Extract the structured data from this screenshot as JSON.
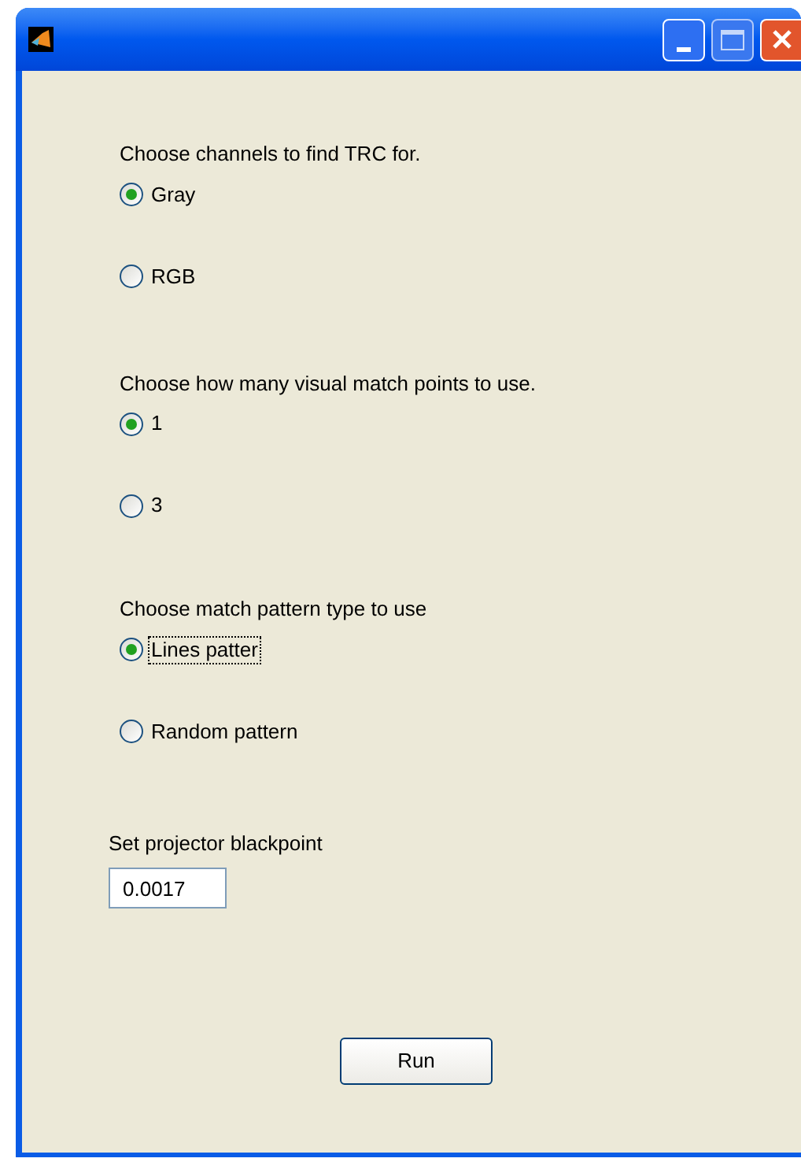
{
  "groups": [
    {
      "prompt": "Choose channels to find TRC for.",
      "options": [
        {
          "label": "Gray",
          "selected": true,
          "focused": false
        },
        {
          "label": "RGB",
          "selected": false,
          "focused": false
        }
      ]
    },
    {
      "prompt": "Choose how many visual match points to use.",
      "options": [
        {
          "label": "1",
          "selected": true,
          "focused": false
        },
        {
          "label": "3",
          "selected": false,
          "focused": false
        }
      ]
    },
    {
      "prompt": "Choose match pattern type to use",
      "options": [
        {
          "label": "Lines patter",
          "selected": true,
          "focused": true
        },
        {
          "label": "Random pattern",
          "selected": false,
          "focused": false
        }
      ]
    }
  ],
  "blackpoint": {
    "label": "Set projector blackpoint",
    "value": "0.0017"
  },
  "run_button": "Run"
}
